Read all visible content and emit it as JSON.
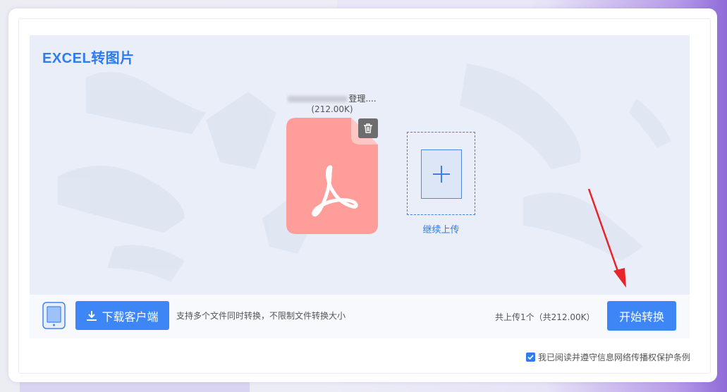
{
  "header": {
    "title": "EXCEL转图片"
  },
  "file": {
    "name": "...转理....",
    "name_visible_tail": "登理....",
    "size": "(212.00K)",
    "icon": "pdf-file-icon",
    "icon_color": "#ff9d9a"
  },
  "upload": {
    "label": "继续上传",
    "icon": "plus-icon"
  },
  "bottom_bar": {
    "download_label": "下载客户端",
    "support_text": "支持多个文件同时转换，不限制文件转换大小",
    "summary": "共上传1个（共212.00K）",
    "start_label": "开始转换"
  },
  "agreement": {
    "checked": true,
    "text": "我已阅读并遵守信息网络传播权保护条例"
  },
  "colors": {
    "accent": "#3e86f5",
    "title": "#2f7bf0",
    "arrow": "#e8232a"
  }
}
